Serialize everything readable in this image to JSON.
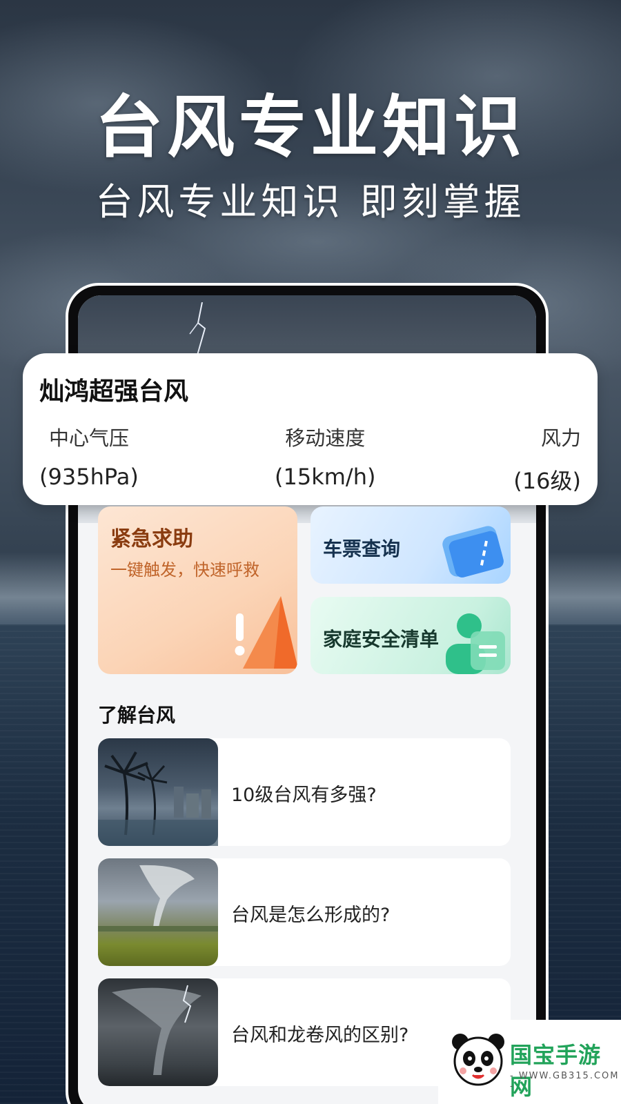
{
  "hero": {
    "title": "台风专业知识",
    "subtitle": "台风专业知识 即刻掌握"
  },
  "typhoon": {
    "name": "灿鸿超强台风",
    "stats": [
      {
        "label": "中心气压",
        "value": "(935hPa)"
      },
      {
        "label": "移动速度",
        "value": "(15km/h)"
      },
      {
        "label": "风力",
        "value": "(16级)"
      }
    ]
  },
  "tiles": {
    "emergency": {
      "title": "紧急求助",
      "subtitle": "一键触发，快速呼救"
    },
    "ticket": {
      "title": "车票查询"
    },
    "family": {
      "title": "家庭安全清单"
    }
  },
  "section": {
    "title": "了解台风"
  },
  "articles": [
    {
      "title": "10级台风有多强?"
    },
    {
      "title": "台风是怎么形成的?"
    },
    {
      "title": "台风和龙卷风的区别?"
    }
  ],
  "watermark": {
    "brand": "国宝手游网",
    "url": "- WWW.GB315.COM -"
  },
  "colors": {
    "emergency_accent": "#f07a3a",
    "ticket_accent": "#3d8ff0",
    "family_accent": "#2fc08a",
    "watermark_green": "#22a35a"
  }
}
